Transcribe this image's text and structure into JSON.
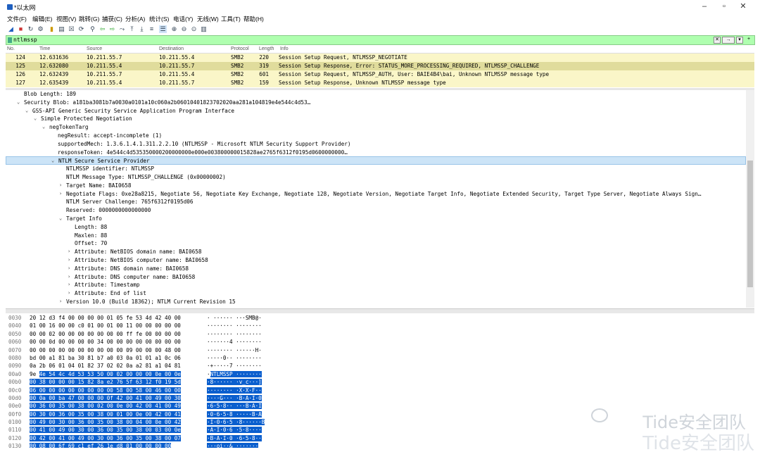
{
  "window": {
    "title": "*以太网"
  },
  "menu": [
    "文件(F)",
    "编辑(E)",
    "视图(V)",
    "跳转(G)",
    "捕获(C)",
    "分析(A)",
    "统计(S)",
    "电话(Y)",
    "无线(W)",
    "工具(T)",
    "帮助(H)"
  ],
  "toolbar_icons": [
    "shark-fin-start-icon",
    "stop-icon",
    "restart-icon",
    "options-icon",
    "open-icon",
    "save-icon",
    "close-file-icon",
    "reload-icon",
    "find-icon",
    "back-icon",
    "forward-icon",
    "goto-icon",
    "first-icon",
    "last-icon",
    "autoscroll-icon",
    "colorize-icon",
    "zoom-in-icon",
    "zoom-out-icon",
    "zoom-reset-icon",
    "resize-columns-icon"
  ],
  "filter": {
    "value": "ntlmssp"
  },
  "packet_columns": {
    "no": "No.",
    "time": "Time",
    "source": "Source",
    "destination": "Destination",
    "protocol": "Protocol",
    "length": "Length",
    "info": "Info"
  },
  "packets": [
    {
      "no": "124",
      "time": "12.631636",
      "source": "10.211.55.7",
      "destination": "10.211.55.4",
      "protocol": "SMB2",
      "length": "220",
      "info": "Session Setup Request, NTLMSSP_NEGOTIATE",
      "selected": false
    },
    {
      "no": "125",
      "time": "12.632080",
      "source": "10.211.55.4",
      "destination": "10.211.55.7",
      "protocol": "SMB2",
      "length": "319",
      "info": "Session Setup Response, Error: STATUS_MORE_PROCESSING_REQUIRED, NTLMSSP_CHALLENGE",
      "selected": true
    },
    {
      "no": "126",
      "time": "12.632439",
      "source": "10.211.55.7",
      "destination": "10.211.55.4",
      "protocol": "SMB2",
      "length": "601",
      "info": "Session Setup Request, NTLMSSP_AUTH, User: BAIE4B4\\bai, Unknown NTLMSSP message type",
      "selected": false
    },
    {
      "no": "127",
      "time": "12.635439",
      "source": "10.211.55.4",
      "destination": "10.211.55.7",
      "protocol": "SMB2",
      "length": "159",
      "info": "Session Setup Response, Unknown NTLMSSP message type",
      "selected": false
    }
  ],
  "details": [
    {
      "indent": 0,
      "arrow": "",
      "text": "Blob Length: 189"
    },
    {
      "indent": 0,
      "arrow": "v",
      "text": "Security Blob: a181ba3081b7a0030a0101a10c060a2b06010401823702020aa281a104819e4e544c4d53…"
    },
    {
      "indent": 1,
      "arrow": "v",
      "text": "GSS-API Generic Security Service Application Program Interface"
    },
    {
      "indent": 2,
      "arrow": "v",
      "text": "Simple Protected Negotiation"
    },
    {
      "indent": 3,
      "arrow": "v",
      "text": "negTokenTarg"
    },
    {
      "indent": 4,
      "arrow": "",
      "text": "negResult: accept-incomplete (1)"
    },
    {
      "indent": 4,
      "arrow": "",
      "text": "supportedMech: 1.3.6.1.4.1.311.2.2.10 (NTLMSSP - Microsoft NTLM Security Support Provider)"
    },
    {
      "indent": 4,
      "arrow": "",
      "text": "responseToken: 4e544c4d535350000200000000e000e003800000015828ae2765f6312f0195d0600000000…"
    },
    {
      "indent": 4,
      "arrow": "v",
      "text": "NTLM Secure Service Provider",
      "selected": true
    },
    {
      "indent": 5,
      "arrow": "",
      "text": "NTLMSSP identifier: NTLMSSP"
    },
    {
      "indent": 5,
      "arrow": "",
      "text": "NTLM Message Type: NTLMSSP_CHALLENGE (0x00000002)"
    },
    {
      "indent": 5,
      "arrow": ">",
      "text": "Target Name: BAI0658"
    },
    {
      "indent": 5,
      "arrow": ">",
      "text": "Negotiate Flags: 0xe28a8215, Negotiate 56, Negotiate Key Exchange, Negotiate 128, Negotiate Version, Negotiate Target Info, Negotiate Extended Security, Target Type Server, Negotiate Always Sign…"
    },
    {
      "indent": 5,
      "arrow": "",
      "text": "NTLM Server Challenge: 765f6312f0195d06"
    },
    {
      "indent": 5,
      "arrow": "",
      "text": "Reserved: 0000000000000000"
    },
    {
      "indent": 5,
      "arrow": "v",
      "text": "Target Info"
    },
    {
      "indent": 6,
      "arrow": "",
      "text": "Length: 88"
    },
    {
      "indent": 6,
      "arrow": "",
      "text": "Maxlen: 88"
    },
    {
      "indent": 6,
      "arrow": "",
      "text": "Offset: 70"
    },
    {
      "indent": 6,
      "arrow": ">",
      "text": "Attribute: NetBIOS domain name: BAI0658"
    },
    {
      "indent": 6,
      "arrow": ">",
      "text": "Attribute: NetBIOS computer name: BAI0658"
    },
    {
      "indent": 6,
      "arrow": ">",
      "text": "Attribute: DNS domain name: BAI0658"
    },
    {
      "indent": 6,
      "arrow": ">",
      "text": "Attribute: DNS computer name: BAI0658"
    },
    {
      "indent": 6,
      "arrow": ">",
      "text": "Attribute: Timestamp"
    },
    {
      "indent": 6,
      "arrow": ">",
      "text": "Attribute: End of list"
    },
    {
      "indent": 5,
      "arrow": ">",
      "text": "Version 10.0 (Build 18362); NTLM Current Revision 15"
    }
  ],
  "bytes": [
    {
      "off": "0030",
      "hex_pre": "20 12 d3 f4 00 00 00 00  01 05 fe 53 4d 42 40 00",
      "hex_hl": "",
      "asc_pre": "· ······ ···SMB@·",
      "asc_hl": ""
    },
    {
      "off": "0040",
      "hex_pre": "01 00 16 00 00 c0 01 00  01 00 11 00 00 00 00 00",
      "hex_hl": "",
      "asc_pre": "········ ········",
      "asc_hl": ""
    },
    {
      "off": "0050",
      "hex_pre": "00 00 02 00 00 00 00 00  00 00 ff fe 00 00 00 00",
      "hex_hl": "",
      "asc_pre": "········ ········",
      "asc_hl": ""
    },
    {
      "off": "0060",
      "hex_pre": "00 00 0d 00 00 00 00 34  00 00 00 00 00 00 00 00",
      "hex_hl": "",
      "asc_pre": "·······4 ········",
      "asc_hl": ""
    },
    {
      "off": "0070",
      "hex_pre": "00 00 00 00 00 00 00 00  00 00 09 00 00 00 48 00",
      "hex_hl": "",
      "asc_pre": "········ ······H·",
      "asc_hl": ""
    },
    {
      "off": "0080",
      "hex_pre": "bd 00 a1 81 ba 30 81 b7  a0 03 0a 01 01 a1 0c 06",
      "hex_hl": "",
      "asc_pre": "·····0·· ········",
      "asc_hl": ""
    },
    {
      "off": "0090",
      "hex_pre": "0a 2b 06 01 04 01 82 37  02 02 0a a2 81 a1 04 81",
      "hex_hl": "",
      "asc_pre": "·+·····7 ········",
      "asc_hl": ""
    },
    {
      "off": "00a0",
      "hex_pre": "9e ",
      "hex_hl": "4e 54 4c 4d 53 53 50  00 02 00 00 00 0e 00 0e",
      "asc_pre": "·",
      "asc_hl": "NTLMSSP ········"
    },
    {
      "off": "00b0",
      "hex_pre": "",
      "hex_hl": "00 38 00 00 00 15 82 8a  e2 76 5f 63 12 f0 19 5d",
      "asc_pre": "",
      "asc_hl": "·8······ ·v_c···]"
    },
    {
      "off": "00c0",
      "hex_pre": "",
      "hex_hl": "06 00 00 00 00 00 00 00  00 58 00 58 00 46 00 00",
      "asc_pre": "",
      "asc_hl": "········ ·X·X·F··"
    },
    {
      "off": "00d0",
      "hex_pre": "",
      "hex_hl": "00 0a 00 ba 47 00 00 00  0f 42 00 41 00 49 00 30",
      "asc_pre": "",
      "asc_hl": "····G··· ·B·A·I·0"
    },
    {
      "off": "00e0",
      "hex_pre": "",
      "hex_hl": "00 36 00 35 00 38 00 02  00 0e 00 42 00 41 00 49",
      "asc_pre": "",
      "asc_hl": "·6·5·8·· ···B·A·I"
    },
    {
      "off": "00f0",
      "hex_pre": "",
      "hex_hl": "00 30 00 36 00 35 00 38  00 01 00 0e 00 42 00 41",
      "asc_pre": "",
      "asc_hl": "·0·6·5·8 ·····B·A"
    },
    {
      "off": "0100",
      "hex_pre": "",
      "hex_hl": "00 49 00 30 00 36 00 35  00 38 00 04 00 0e 00 42",
      "asc_pre": "",
      "asc_hl": "·I·0·6·5 ·8······B"
    },
    {
      "off": "0110",
      "hex_pre": "",
      "hex_hl": "00 41 00 49 00 30 00 36  00 35 00 38 00 03 00 0e",
      "asc_pre": "",
      "asc_hl": "·A·I·0·6 ·5·8····"
    },
    {
      "off": "0120",
      "hex_pre": "",
      "hex_hl": "00 42 00 41 00 49 00 30  00 36 00 35 00 38 00 07",
      "asc_pre": "",
      "asc_hl": "·B·A·I·0 ·6·5·8··"
    },
    {
      "off": "0130",
      "hex_pre": "",
      "hex_hl": "00 08 00 6f 69 c1 ef 26  1e d8 01 00 00 00 00",
      "asc_pre": "",
      "asc_hl": "···oi··& ·······"
    }
  ],
  "watermark": {
    "line1": "Tide安全团队",
    "line2": "Tide安全团队"
  }
}
